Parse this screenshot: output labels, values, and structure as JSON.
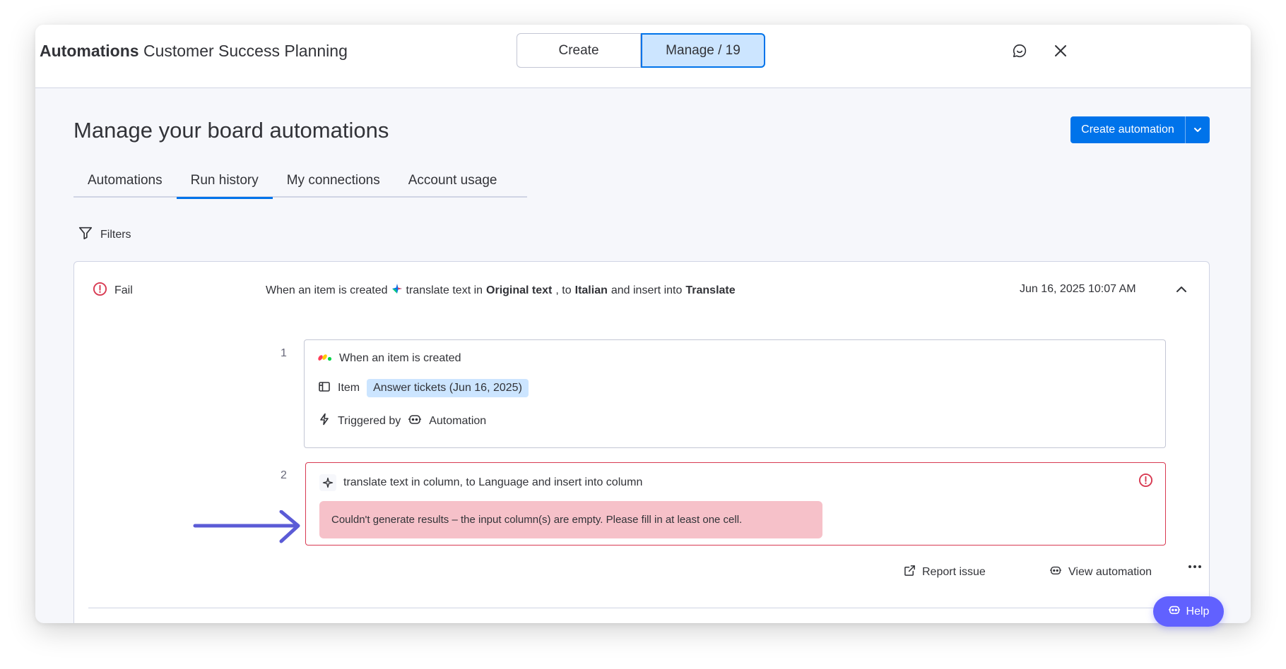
{
  "header": {
    "app_name": "Automations",
    "board_name": "Customer Success Planning",
    "segments": {
      "create": "Create",
      "manage": "Manage / 19"
    }
  },
  "page": {
    "title": "Manage your board automations",
    "create_button": "Create automation"
  },
  "tabs": [
    {
      "label": "Automations"
    },
    {
      "label": "Run history"
    },
    {
      "label": "My connections"
    },
    {
      "label": "Account usage"
    }
  ],
  "filters_label": "Filters",
  "run": {
    "status": "Fail",
    "desc": {
      "trigger": "When an item is created",
      "action": "translate text in",
      "source": "Original text",
      "sep": ", to",
      "language": "Italian",
      "insert": "and insert into",
      "target": "Translate"
    },
    "date": "Jun 16, 2025 10:07 AM",
    "steps": [
      {
        "number": "1",
        "title": "When an item is created",
        "item_label": "Item",
        "item_value": "Answer tickets (Jun 16, 2025)",
        "triggered_label": "Triggered by",
        "triggered_value": "Automation"
      },
      {
        "number": "2",
        "title": "translate text in column, to Language and insert into column",
        "error": "Couldn't generate results – the input column(s) are empty. Please fill in at least one cell."
      }
    ],
    "actions": {
      "report": "Report issue",
      "view": "View automation"
    }
  },
  "help_label": "Help",
  "colors": {
    "primary": "#0073ea",
    "error": "#d83a52",
    "error_bg": "#f6c1c9",
    "help": "#6161ff",
    "arrow": "#5b5bd6"
  }
}
